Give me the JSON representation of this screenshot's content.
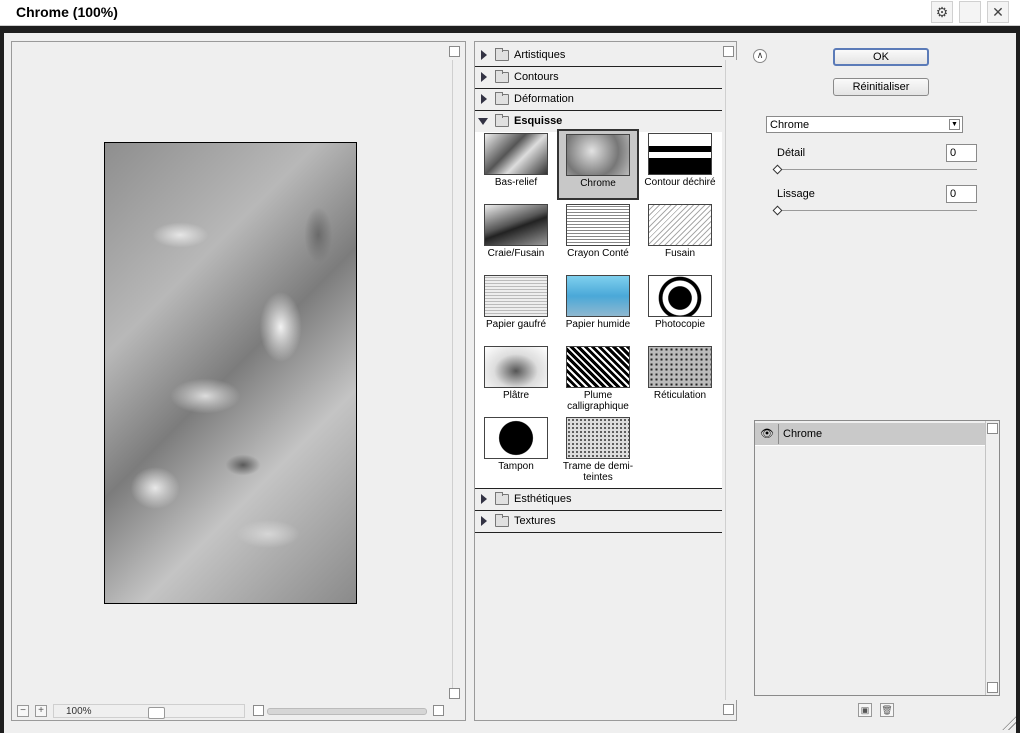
{
  "window": {
    "title": "Chrome (100%)"
  },
  "preview": {
    "zoom": "100%"
  },
  "gallery": {
    "categories_before": [
      {
        "label": "Artistiques"
      },
      {
        "label": "Contours"
      },
      {
        "label": "Déformation"
      }
    ],
    "open_category": "Esquisse",
    "filters": [
      {
        "label": "Bas-relief"
      },
      {
        "label": "Chrome"
      },
      {
        "label": "Contour déchiré"
      },
      {
        "label": "Craie/Fusain"
      },
      {
        "label": "Crayon Conté"
      },
      {
        "label": "Fusain"
      },
      {
        "label": "Papier gaufré"
      },
      {
        "label": "Papier humide"
      },
      {
        "label": "Photocopie"
      },
      {
        "label": "Plâtre"
      },
      {
        "label": "Plume calligraphique"
      },
      {
        "label": "Réticulation"
      },
      {
        "label": "Tampon"
      },
      {
        "label": "Trame de demi-teintes"
      }
    ],
    "selected_filter": "Chrome",
    "categories_after": [
      {
        "label": "Esthétiques"
      },
      {
        "label": "Textures"
      }
    ]
  },
  "controls": {
    "ok_label": "OK",
    "reset_label": "Réinitialiser",
    "filter_select": "Chrome",
    "detail_label": "Détail",
    "detail_value": "0",
    "smooth_label": "Lissage",
    "smooth_value": "0"
  },
  "layers": {
    "items": [
      {
        "name": "Chrome",
        "visible": true
      }
    ]
  },
  "colors": {
    "ok_border": "#5b7bb8",
    "selected_layer": "#c9c9c9"
  }
}
